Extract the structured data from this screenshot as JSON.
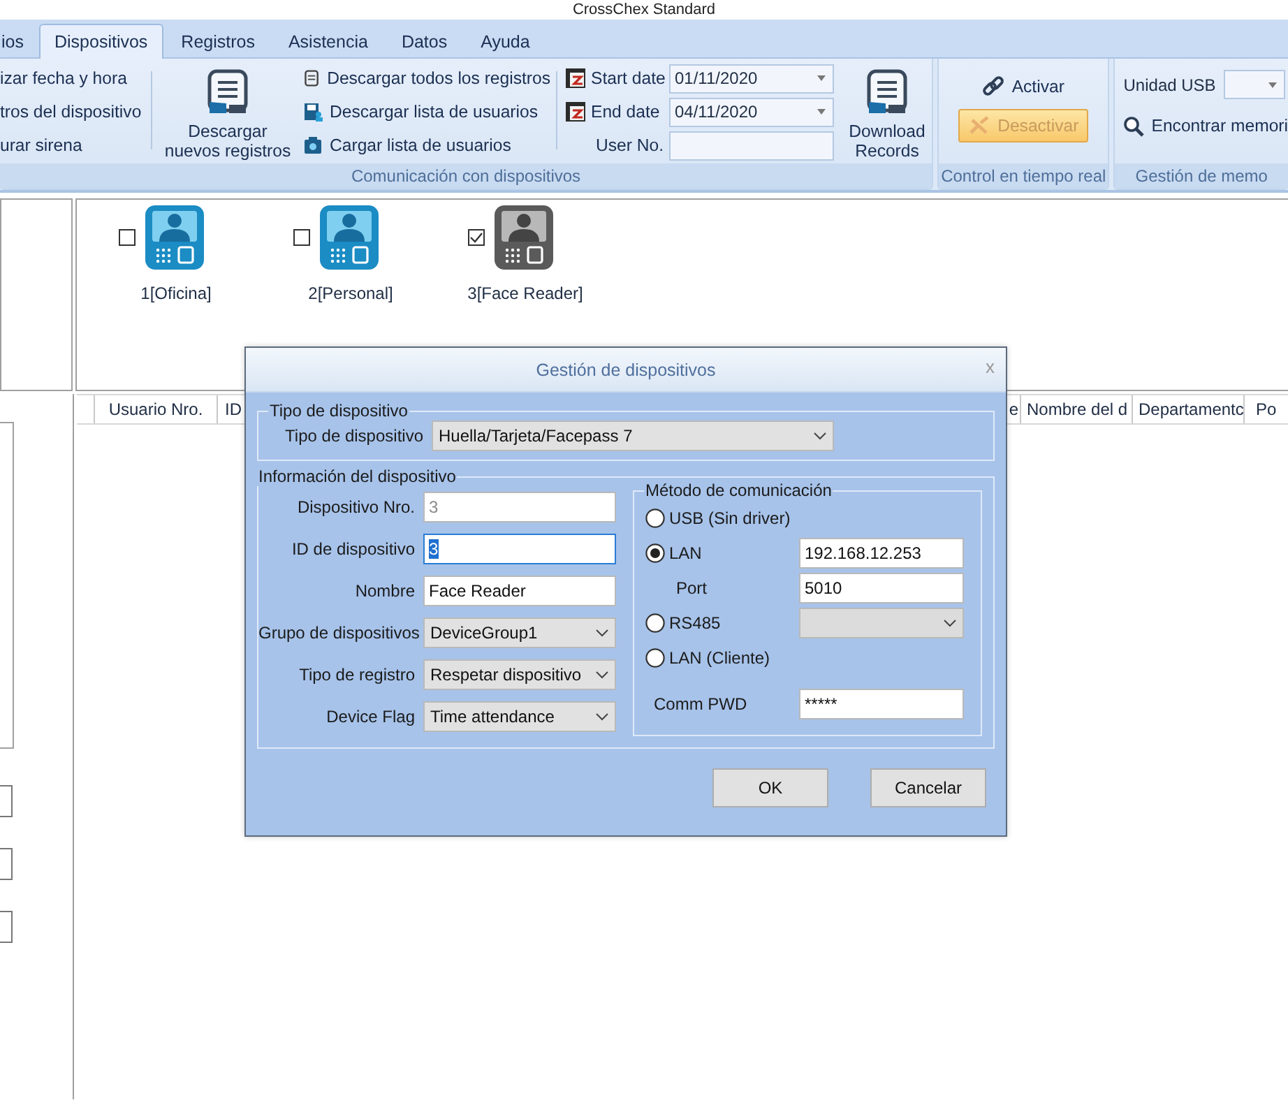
{
  "window": {
    "title": "CrossChex Standard"
  },
  "tabs": [
    {
      "label": "ios",
      "selected": false
    },
    {
      "label": "Dispositivos",
      "selected": true
    },
    {
      "label": "Registros",
      "selected": false
    },
    {
      "label": "Asistencia",
      "selected": false
    },
    {
      "label": "Datos",
      "selected": false
    },
    {
      "label": "Ayuda",
      "selected": false
    }
  ],
  "ribbon": {
    "communication": {
      "label": "Comunicación con dispositivos",
      "clipped_items": [
        "izar fecha y hora",
        "tros del dispositivo",
        "urar sirena"
      ],
      "download_new": [
        "Descargar",
        "nuevos registros"
      ],
      "actions": [
        "Descargar todos los registros",
        "Descargar lista de usuarios",
        "Cargar lista de usuarios"
      ],
      "start_date": {
        "label": "Start date",
        "value": "01/11/2020"
      },
      "end_date": {
        "label": "End date",
        "value": "04/11/2020"
      },
      "user_no": {
        "label": "User No."
      },
      "download_records": [
        "Download",
        "Records"
      ]
    },
    "realtime": {
      "label": "Control en tiempo real",
      "activate": "Activar",
      "deactivate": {
        "label": "Desactivar",
        "highlighted": true
      }
    },
    "memory": {
      "label": "Gestión de memo",
      "usb_label": "Unidad USB",
      "find": "Encontrar memori"
    }
  },
  "devices": [
    {
      "label": "1[Oficina]",
      "checked": false,
      "connected": true
    },
    {
      "label": "2[Personal]",
      "checked": false,
      "connected": true
    },
    {
      "label": "3[Face Reader]",
      "checked": true,
      "connected": false
    }
  ],
  "table": {
    "columns_left": [
      "Usuario Nro.",
      "ID"
    ],
    "columns_right": [
      "e",
      "Nombre del d",
      "Departamentc",
      "Po"
    ]
  },
  "dialog": {
    "title": "Gestión de dispositivos",
    "close": "x",
    "device_type": {
      "legend": "Tipo de dispositivo",
      "label": "Tipo de dispositivo",
      "value": "Huella/Tarjeta/Facepass 7"
    },
    "info": {
      "legend": "Información del dispositivo",
      "fields": [
        {
          "kind": "text",
          "label": "Dispositivo Nro.",
          "value": "3",
          "disabled": true,
          "focused": false
        },
        {
          "kind": "text",
          "label": "ID de dispositivo",
          "value": "3",
          "disabled": false,
          "focused": true
        },
        {
          "kind": "text",
          "label": "Nombre",
          "value": "Face Reader",
          "disabled": false,
          "focused": false
        },
        {
          "kind": "select",
          "label": "Grupo de dispositivos",
          "value": "DeviceGroup1"
        },
        {
          "kind": "select",
          "label": "Tipo de registro",
          "value": "Respetar dispositivo"
        },
        {
          "kind": "select",
          "label": "Device Flag",
          "value": "Time attendance"
        }
      ]
    },
    "comm": {
      "legend": "Método de comunicación",
      "rows": [
        {
          "kind": "radio",
          "label": "USB (Sin driver)",
          "selected": false
        },
        {
          "kind": "radio",
          "label": "LAN",
          "selected": true,
          "value": "192.168.12.253"
        },
        {
          "kind": "field",
          "label": "Port",
          "value": "5010"
        },
        {
          "kind": "radio",
          "label": "RS485",
          "selected": false,
          "dropdown": true
        },
        {
          "kind": "radio",
          "label": "LAN (Cliente)",
          "selected": false
        },
        {
          "kind": "field",
          "label": "Comm PWD",
          "value": "*****"
        }
      ]
    },
    "buttons": [
      "OK",
      "Cancelar"
    ]
  }
}
